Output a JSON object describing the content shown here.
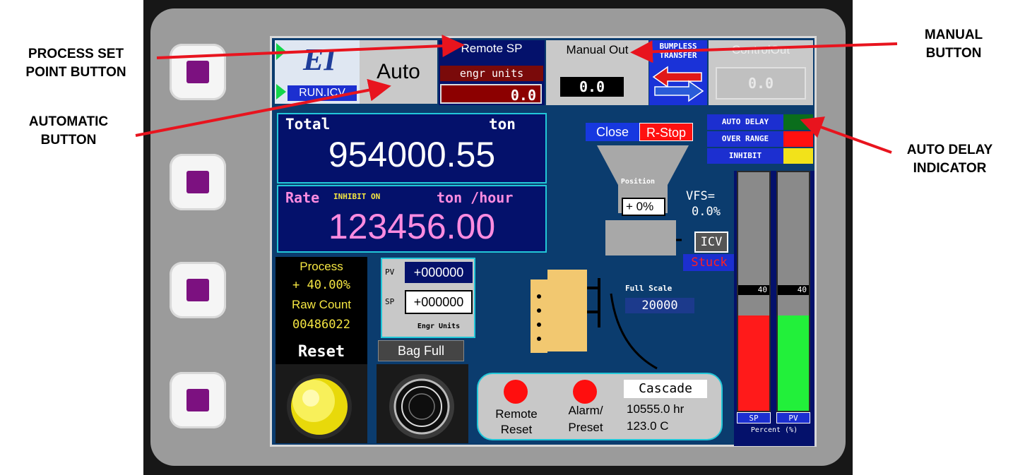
{
  "callouts": {
    "process_set_point": [
      "PROCESS SET",
      "POINT BUTTON"
    ],
    "automatic": [
      "AUTOMATIC",
      "BUTTON"
    ],
    "manual": [
      "MANUAL",
      "BUTTON"
    ],
    "auto_delay": [
      "AUTO DELAY",
      "INDICATOR"
    ]
  },
  "header": {
    "logo": "EI",
    "run_label": "RUN.ICV",
    "auto_label": "Auto",
    "remote_sp_label": "Remote SP",
    "engr_units_label": "engr units",
    "remote_sp_value": "0.0",
    "manual_out_label": "Manual Out",
    "manual_out_value": "0.0",
    "bumpless_line1": "BUMPLESS",
    "bumpless_line2": "TRANSFER",
    "control_out_label": "ControlOut",
    "control_out_value": "0.0"
  },
  "total": {
    "label": "Total",
    "unit": "ton",
    "value": "954000.55"
  },
  "rate": {
    "label": "Rate",
    "inhibit": "INHIBIT ON",
    "unit": "ton /hour",
    "value": "123456.00"
  },
  "gate": {
    "close_label": "Close",
    "rstop_label": "R-Stop",
    "position_label": "Position",
    "position_value": "+ 0%",
    "vfs_label": "VFS=",
    "vfs_value": "0.0%",
    "icv_label": "ICV",
    "stuck_label": "Stuck"
  },
  "indicators": [
    {
      "label": "AUTO DELAY",
      "color": "#0a6e1c"
    },
    {
      "label": "OVER RANGE",
      "color": "#ff1010"
    },
    {
      "label": "INHIBIT",
      "color": "#f2e21a"
    }
  ],
  "bars": {
    "sp": {
      "label": "SP",
      "value_label": "40",
      "fill": 0.4,
      "color": "#ff1a1a"
    },
    "pv": {
      "label": "PV",
      "value_label": "40",
      "fill": 0.4,
      "color": "#22f03a"
    },
    "caption": "Percent (%)"
  },
  "process": {
    "label": "Process",
    "value": "+ 40.00%",
    "raw_label": "Raw Count",
    "raw_value": "00486022"
  },
  "pv_sp": {
    "pv_tag": "PV",
    "pv_value": "+000000",
    "sp_tag": "SP",
    "sp_value": "+000000",
    "units": "Engr Units"
  },
  "full_scale": {
    "label": "Full Scale",
    "value": "20000"
  },
  "reset_label": "Reset",
  "bag_full_label": "Bag Full",
  "bottom_panel": {
    "remote_reset": [
      "Remote",
      "Reset"
    ],
    "alarm_preset": [
      "Alarm/",
      "Preset"
    ],
    "cascade_label": "Cascade",
    "hours": "10555.0 hr",
    "temp": "123.0 C"
  }
}
